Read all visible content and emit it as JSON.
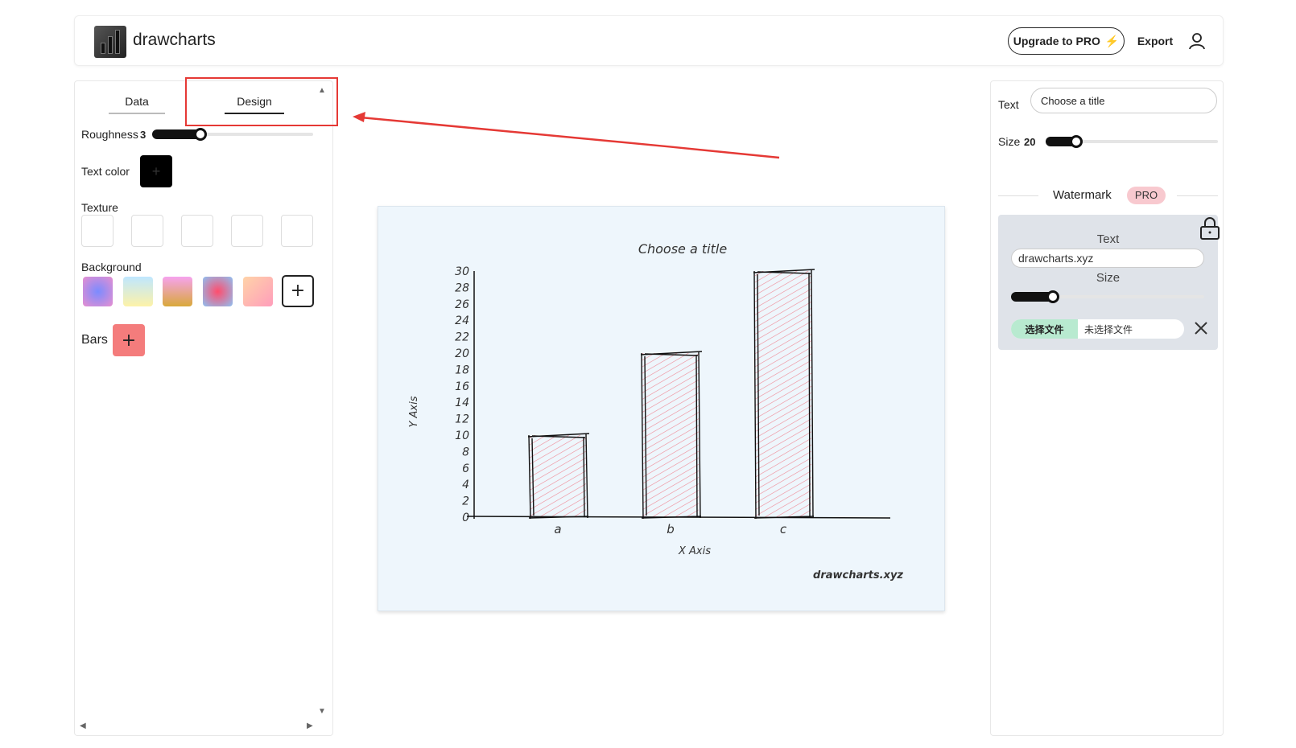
{
  "header": {
    "brand": "drawcharts",
    "upgrade_label": "Upgrade to PRO",
    "export_label": "Export",
    "icons": {
      "logo": "bar-logo-icon",
      "bolt": "lightning-icon",
      "user": "user-icon"
    }
  },
  "left_panel": {
    "tabs": [
      {
        "label": "Data",
        "active": false
      },
      {
        "label": "Design",
        "active": true
      }
    ],
    "roughness": {
      "label": "Roughness",
      "value": "3",
      "fraction": 0.3
    },
    "text_color": {
      "label": "Text color",
      "value": "#000000"
    },
    "texture": {
      "label": "Texture",
      "count": 5
    },
    "background": {
      "label": "Background",
      "swatches": [
        "radial-gradient(circle, #7b8bff, #e78fd0)",
        "linear-gradient(180deg, #bfe7ff, #fdf2a8)",
        "linear-gradient(180deg, #f6a3ee, #d9a83a)",
        "radial-gradient(circle, #ff4d6d, #8ec0f2)",
        "linear-gradient(135deg, #ffd3a8, #ff9dbb)"
      ],
      "add_symbol": "+"
    },
    "bars": {
      "label": "Bars",
      "add_symbol": "+",
      "color": "#f47c7c"
    }
  },
  "annotation": {
    "color": "#e53935"
  },
  "chart_data": {
    "type": "bar",
    "title": "Choose a title",
    "xlabel": "X Axis",
    "ylabel": "Y Axis",
    "categories": [
      "a",
      "b",
      "c"
    ],
    "values": [
      10,
      20,
      30
    ],
    "ylim": [
      0,
      30
    ],
    "yticks": [
      0,
      2,
      4,
      6,
      8,
      10,
      12,
      14,
      16,
      18,
      20,
      22,
      24,
      26,
      28,
      30
    ],
    "bar_color": "#f2a0a8",
    "background": "#eef6fc",
    "watermark": "drawcharts.xyz",
    "grid": false,
    "style": "hand-drawn"
  },
  "right_panel": {
    "title_text_label": "Text",
    "title_placeholder": "Choose a title",
    "size_label": "Size",
    "size_value": "20",
    "size_fraction": 0.15,
    "watermark": {
      "heading": "Watermark",
      "pro_badge": "PRO",
      "text_label": "Text",
      "text_value": "drawcharts.xyz",
      "size_label": "Size",
      "size_fraction": 0.22,
      "file_button": "选择文件",
      "file_status": "未选择文件"
    }
  }
}
